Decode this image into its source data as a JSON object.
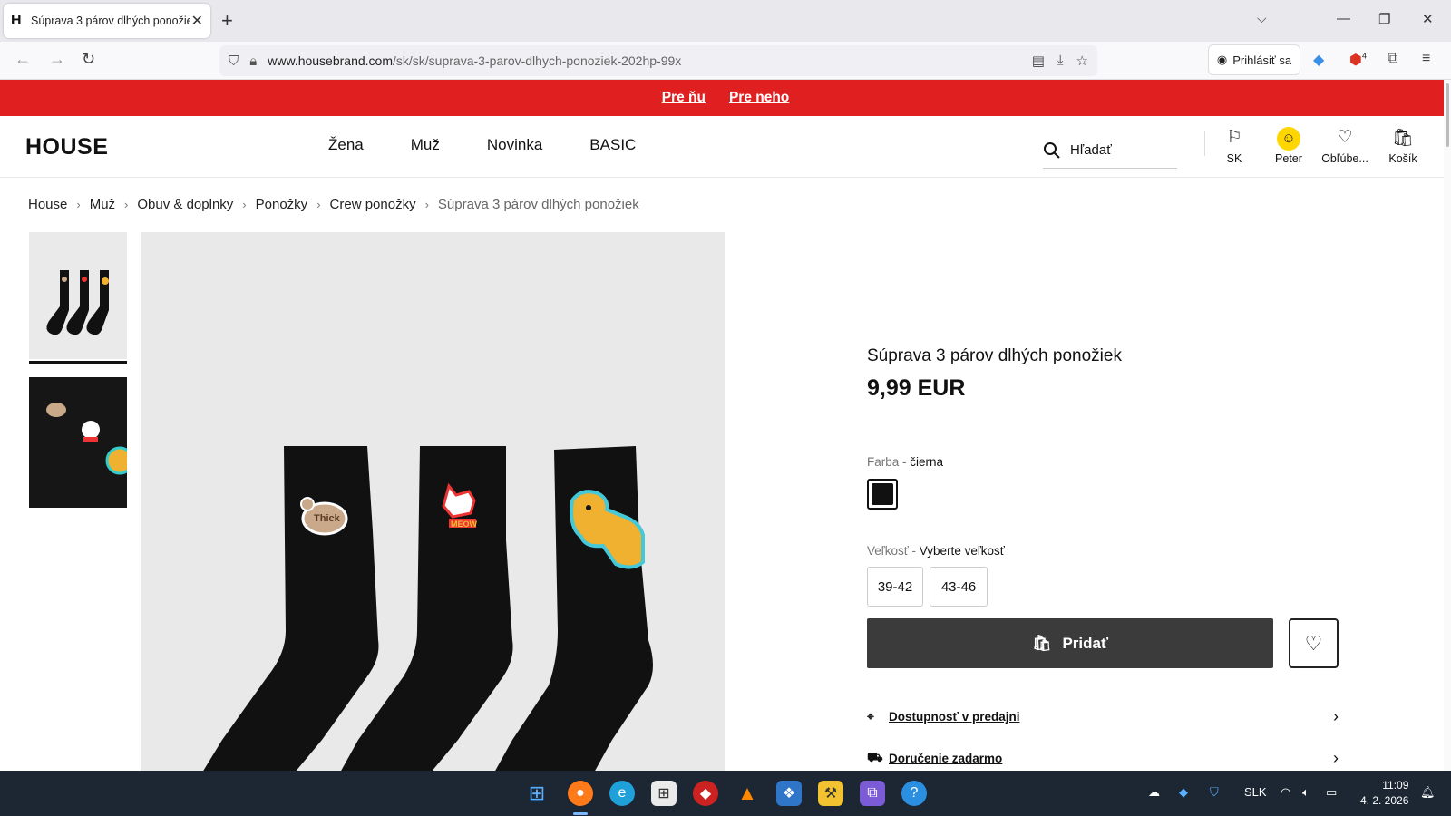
{
  "browser": {
    "tab_title": "Súprava 3 párov dlhých ponožie",
    "tab_favicon": "H",
    "url_domain": "www.housebrand.com",
    "url_path": "/sk/sk/suprava-3-parov-dlhych-ponoziek-202hp-99x",
    "signin_label": "Prihlásiť sa",
    "ext_badge": "4"
  },
  "promo": {
    "links": [
      "Pre ňu",
      "Pre neho"
    ],
    "background": "#e02020"
  },
  "site": {
    "logo": "HOUSE",
    "nav": [
      "Žena",
      "Muž",
      "Novinka",
      "BASIC"
    ],
    "search_placeholder": "Hľadať",
    "header_icons": {
      "country": "SK",
      "account": "Peter",
      "favorites": "Obľúbe...",
      "cart": "Košík"
    }
  },
  "breadcrumb": [
    "House",
    "Muž",
    "Obuv & doplnky",
    "Ponožky",
    "Crew ponožky",
    "Súprava 3 párov dlhých ponožiek"
  ],
  "product": {
    "title": "Súprava 3 párov dlhých ponožiek",
    "price": "9,99 EUR",
    "color_label": "Farba -",
    "color_value": "čierna",
    "size_label": "Veľkosť -",
    "size_value": "Vyberte veľkosť",
    "sizes": [
      "39-42",
      "43-46"
    ],
    "add_label": "Pridať",
    "availability_link": "Dostupnosť v predajni",
    "delivery_link": "Doručenie zadarmo",
    "patches": [
      "Thick",
      "MEOW"
    ]
  },
  "taskbar": {
    "language": "SLK",
    "time": "11:09",
    "date": "4. 2. 2026"
  }
}
